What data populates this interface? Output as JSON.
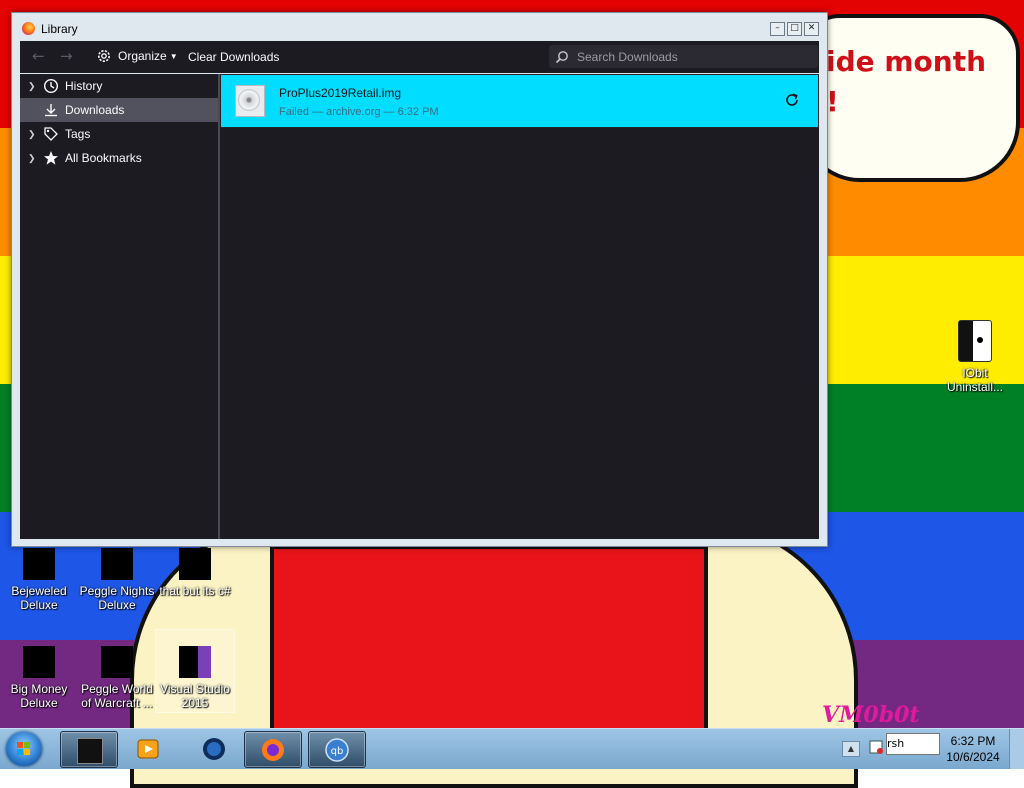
{
  "desktop": {
    "wallpaper_text": [
      "ide month",
      "!"
    ],
    "watermark": "VM0b0t",
    "icons": [
      {
        "label": "Bejeweled Deluxe"
      },
      {
        "label": "Peggle Nights Deluxe"
      },
      {
        "label": "that but its c#"
      },
      {
        "label": "Big Money Deluxe"
      },
      {
        "label": "Peggle World of Warcraft ..."
      },
      {
        "label": "Visual Studio 2015"
      },
      {
        "label": "IObit Uninstall..."
      }
    ]
  },
  "window": {
    "title": "Library",
    "controls": [
      "minimize",
      "maximize",
      "close"
    ],
    "toolbar": {
      "organize_label": "Organize",
      "clear_label": "Clear Downloads",
      "search_placeholder": "Search Downloads"
    },
    "sidebar": {
      "items": [
        {
          "label": "History",
          "icon": "clock-icon",
          "expandable": true
        },
        {
          "label": "Downloads",
          "icon": "download-icon",
          "expandable": false,
          "selected": true
        },
        {
          "label": "Tags",
          "icon": "tag-icon",
          "expandable": true
        },
        {
          "label": "All Bookmarks",
          "icon": "star-icon",
          "expandable": true
        }
      ]
    },
    "downloads": [
      {
        "filename": "ProPlus2019Retail.img",
        "status": "Failed — archive.org — 6:32 PM",
        "action_icon": "retry-icon"
      }
    ]
  },
  "taskbar": {
    "clock_time": "6:32 PM",
    "clock_date": "10/6/2024",
    "tooltip_fragment": "rsh Comp",
    "tasks": [
      "terminal",
      "media-player",
      "globe",
      "firefox",
      "qbittorrent"
    ]
  },
  "colors": {
    "selected_download": "#00ddff",
    "panel_bg": "#1c1b22",
    "sidebar_selected": "#52525e"
  }
}
